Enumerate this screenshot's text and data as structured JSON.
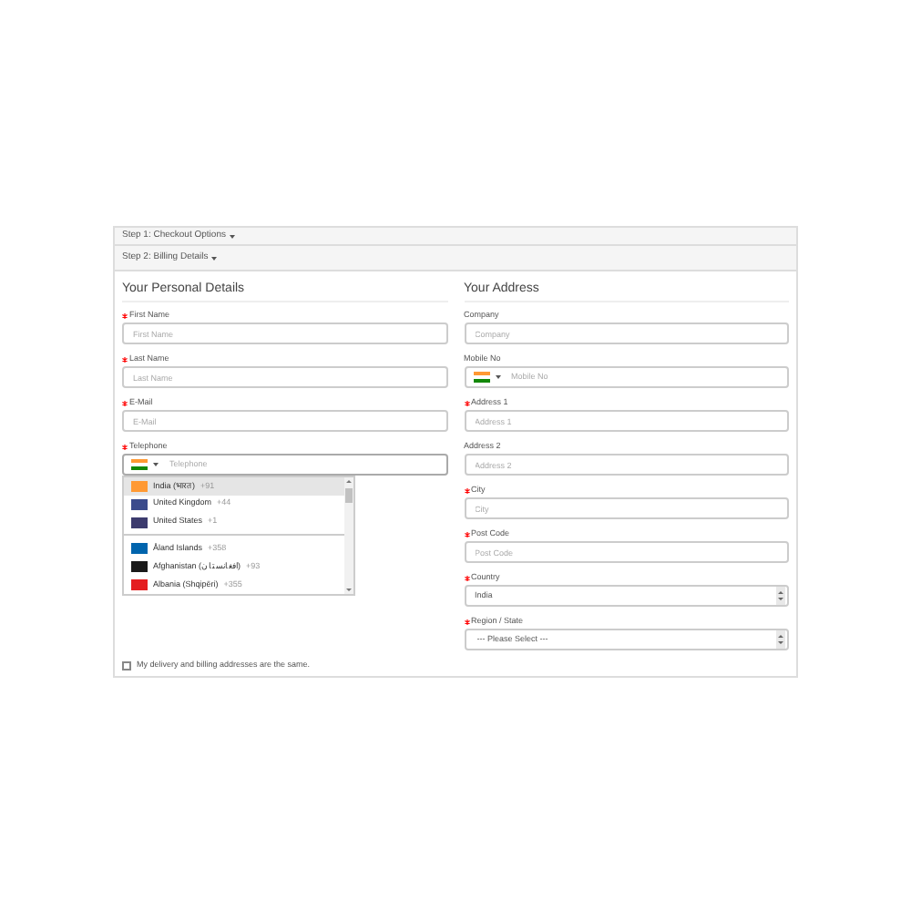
{
  "steps": [
    {
      "title": "Step 1: Checkout Options"
    },
    {
      "title": "Step 2: Billing Details"
    }
  ],
  "personal": {
    "heading": "Your Personal Details",
    "fields": [
      {
        "kind": "text",
        "label": "First Name",
        "required": true,
        "placeholder": "First Name"
      },
      {
        "kind": "text",
        "label": "Last Name",
        "required": true,
        "placeholder": "Last Name"
      },
      {
        "kind": "text",
        "label": "E-Mail",
        "required": true,
        "placeholder": "E-Mail"
      },
      {
        "kind": "phone",
        "label": "Telephone",
        "required": true,
        "placeholder": "Telephone",
        "expanded": true
      }
    ]
  },
  "phone_dropdown": {
    "preferred": [
      {
        "name": "India (भारत)",
        "code": "+91",
        "color": "#ff9933",
        "selected": true
      },
      {
        "name": "United Kingdom",
        "code": "+44",
        "color": "#3b4b8c",
        "selected": false
      },
      {
        "name": "United States",
        "code": "+1",
        "color": "#3c3b6e",
        "selected": false
      }
    ],
    "all": [
      {
        "name": "Åland Islands",
        "code": "+358",
        "color": "#0064ad",
        "selected": false
      },
      {
        "name": "Afghanistan (‫افغانستان‬‎)",
        "code": "+93",
        "color": "#1a1a1a",
        "selected": false
      },
      {
        "name": "Albania (Shqipëri)",
        "code": "+355",
        "color": "#e41e20",
        "selected": false
      }
    ]
  },
  "address": {
    "heading": "Your Address",
    "fields": [
      {
        "kind": "text",
        "label": "Company",
        "required": false,
        "placeholder": "Company"
      },
      {
        "kind": "phone",
        "label": "Mobile No",
        "required": false,
        "placeholder": "Mobile No",
        "expanded": false
      },
      {
        "kind": "text",
        "label": "Address 1",
        "required": true,
        "placeholder": "Address 1"
      },
      {
        "kind": "text",
        "label": "Address 2",
        "required": false,
        "placeholder": "Address 2"
      },
      {
        "kind": "text",
        "label": "City",
        "required": true,
        "placeholder": "City"
      },
      {
        "kind": "text",
        "label": "Post Code",
        "required": true,
        "placeholder": "Post Code"
      },
      {
        "kind": "select",
        "label": "Country",
        "required": true,
        "value": "India"
      },
      {
        "kind": "select",
        "label": "Region / State",
        "required": true,
        "value": " --- Please Select --- "
      }
    ]
  },
  "same_address": {
    "label": "My delivery and billing addresses are the same.",
    "checked": false
  }
}
